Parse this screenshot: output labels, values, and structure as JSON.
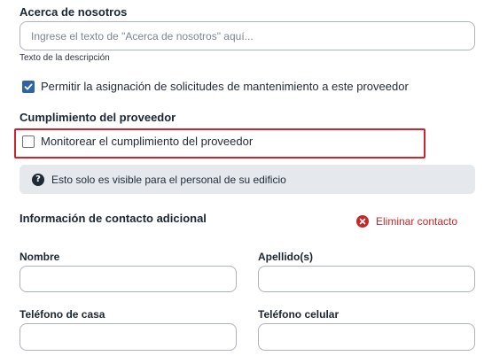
{
  "about": {
    "label": "Acerca de nosotros",
    "placeholder": "Ingrese el texto de \"Acerca de nosotros\" aquí...",
    "value": "",
    "helper": "Texto de la descripción"
  },
  "maintenance_assignment": {
    "label": "Permitir la asignación de solicitudes de mantenimiento a este proveedor",
    "checked": true
  },
  "compliance": {
    "heading": "Cumplimiento del proveedor",
    "monitor_label": "Monitorear el cumplimiento del proveedor",
    "monitor_checked": false,
    "info_text": "Esto solo es visible para el personal de su edificio"
  },
  "additional_contact": {
    "heading": "Información de contacto adicional",
    "remove_label": "Eliminar contacto",
    "fields": {
      "first_name": {
        "label": "Nombre",
        "value": ""
      },
      "last_name": {
        "label": "Apellido(s)",
        "value": ""
      },
      "home_phone": {
        "label": "Teléfono de casa",
        "value": ""
      },
      "cell_phone": {
        "label": "Teléfono celular",
        "value": ""
      }
    }
  },
  "colors": {
    "accent": "#2f63a8",
    "danger": "#c62828",
    "highlight": "#d0232d",
    "info_background": "#e5e9ee"
  },
  "icons": {
    "checkbox_checked": "checkmark-icon",
    "info": "question-circle-icon",
    "remove": "close-circle-icon"
  }
}
